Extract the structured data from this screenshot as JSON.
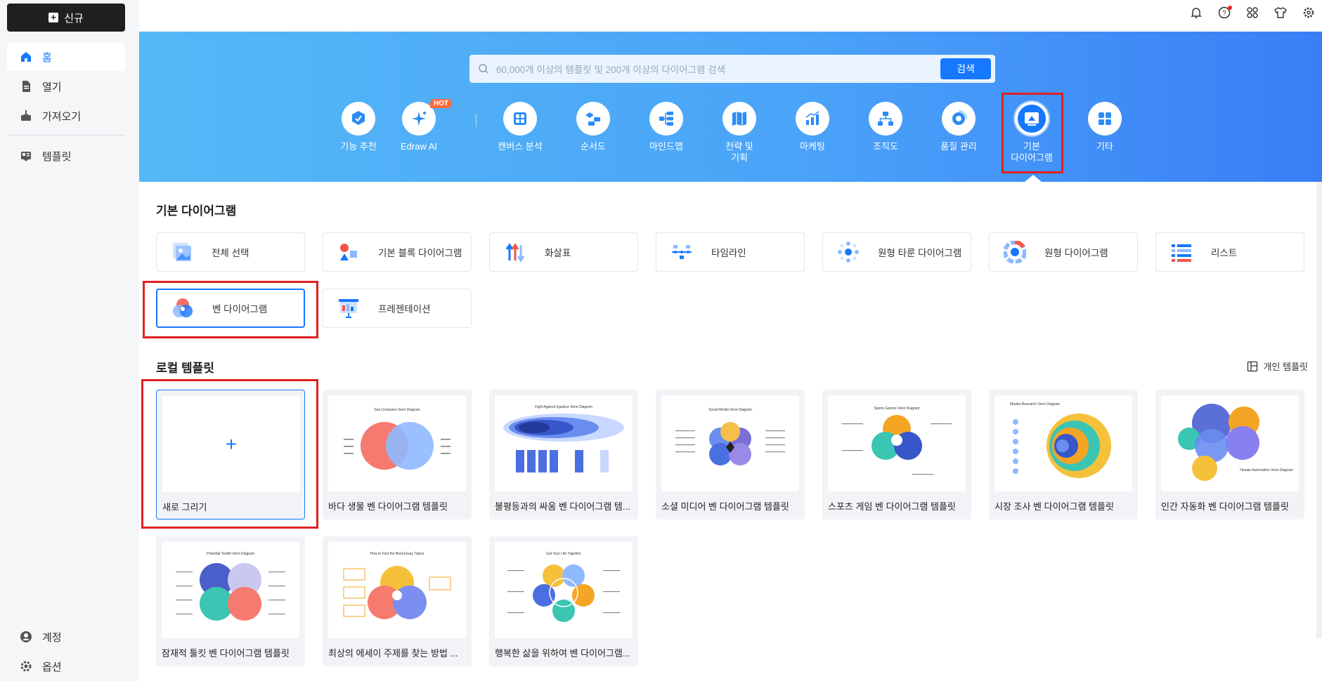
{
  "sidebar": {
    "new_label": "신규",
    "items": [
      {
        "label": "홈",
        "icon": "home-icon"
      },
      {
        "label": "열기",
        "icon": "file-icon"
      },
      {
        "label": "가져오기",
        "icon": "import-icon"
      },
      {
        "label": "템플릿",
        "icon": "template-icon"
      }
    ],
    "bottom": [
      {
        "label": "계정",
        "icon": "user-icon"
      },
      {
        "label": "옵션",
        "icon": "gear-icon"
      }
    ]
  },
  "topbar": {
    "icons": [
      "bell-icon",
      "help-icon",
      "apps-icon",
      "shirt-icon",
      "settings-icon"
    ]
  },
  "search": {
    "placeholder": "60,000개 이상의 템플릿 및 200개 이상의 다이어그램 검색",
    "button": "검색"
  },
  "categories": [
    {
      "label": "기능 추천",
      "icon": "feature-icon"
    },
    {
      "label": "Edraw AI",
      "icon": "ai-sparkle-icon",
      "badge": "HOT"
    },
    {
      "label": "캔버스 분석",
      "icon": "canvas-icon"
    },
    {
      "label": "순서도",
      "icon": "flowchart-icon"
    },
    {
      "label": "마인드맵",
      "icon": "mindmap-icon"
    },
    {
      "label": "전략 및\n기획",
      "icon": "strategy-icon"
    },
    {
      "label": "마케팅",
      "icon": "marketing-icon"
    },
    {
      "label": "조직도",
      "icon": "orgchart-icon"
    },
    {
      "label": "품질 관리",
      "icon": "quality-icon"
    },
    {
      "label": "기본\n다이어그램",
      "icon": "basic-diagram-icon",
      "active": true
    },
    {
      "label": "기타",
      "icon": "more-icon"
    }
  ],
  "basic_section": {
    "title": "기본 다이어그램",
    "cards": [
      {
        "label": "전체 선택",
        "icon": "all-icon"
      },
      {
        "label": "기본 블록 다이어그램",
        "icon": "block-icon"
      },
      {
        "label": "화살표",
        "icon": "arrow-icon"
      },
      {
        "label": "타임라인",
        "icon": "timeline-icon"
      },
      {
        "label": "원형 타룬 다이어그램",
        "icon": "radial-icon"
      },
      {
        "label": "원형 다이어그램",
        "icon": "circle-icon"
      },
      {
        "label": "리스트",
        "icon": "list-icon"
      },
      {
        "label": "벤 다이어그램",
        "icon": "venn-icon",
        "selected": true
      },
      {
        "label": "프레젠테이션",
        "icon": "presentation-icon"
      }
    ]
  },
  "local_section": {
    "title": "로컬 템플릿",
    "personal": "개인 템플릿",
    "new_label": "새로 그리기",
    "templates": [
      {
        "label": "바다 생물 벤 다이어그램 템플릿",
        "thumb_title": "Sea Creatures Venn Diagram"
      },
      {
        "label": "불평등과의 싸움 벤 다이어그램 템...",
        "thumb_title": "Fight Against Injustice Venn Diagram"
      },
      {
        "label": "소셜 미디어 벤 다이어그램 템플릿",
        "thumb_title": "Social Media Venn Diagram"
      },
      {
        "label": "스포츠 게임 벤 다이어그램 템플릿",
        "thumb_title": "Sports Games Venn Diagram"
      },
      {
        "label": "시장 조사 벤 다이어그램 템플릿",
        "thumb_title": "Market Research Venn Diagram"
      },
      {
        "label": "인간 자동화 벤 다이어그램 템플릿",
        "thumb_title": "Human Automation Venn Diagram"
      },
      {
        "label": "잠재적 툴킷 벤 다이어그램 템플릿",
        "thumb_title": "Potential Toolkit Venn Diagram"
      },
      {
        "label": "최상의 에세이 주제를 찾는 방법 ...",
        "thumb_title": "How to Find the Best Essay Topics"
      },
      {
        "label": "행복한 삶을 위하여 벤 다이어그램...",
        "thumb_title": "Get Your Life Together"
      }
    ]
  },
  "colors": {
    "accent": "#1677ff",
    "highlight": "#e02020",
    "sidebar_bg": "#f5f6f8",
    "dark_button": "#1f1f1f"
  }
}
